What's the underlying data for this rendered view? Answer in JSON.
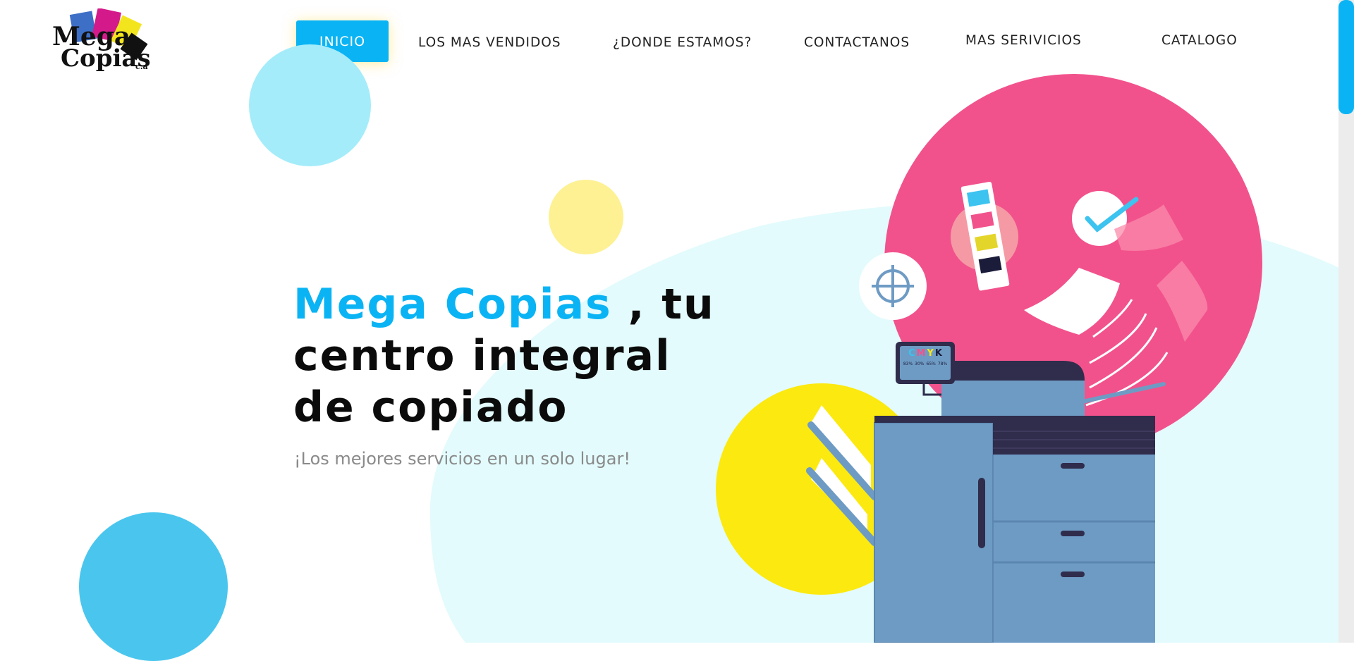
{
  "brand": {
    "logo_line1": "Mega",
    "logo_line2": "Copias",
    "logo_suffix": "c.a"
  },
  "nav": {
    "items": [
      {
        "label": "INICIO",
        "active": true
      },
      {
        "label": "LOS MAS VENDIDOS"
      },
      {
        "label": "¿DONDE ESTAMOS?"
      },
      {
        "label": "CONTACTANOS"
      },
      {
        "label": "MAS SERIVICIOS"
      },
      {
        "label": "CATALOGO"
      }
    ]
  },
  "hero": {
    "brand": "Mega Copias",
    "title_rest": " , tu centro integral de copiado",
    "subtitle": "¡Los mejores servicios en un solo lugar!"
  },
  "illustration": {
    "monitor_letters": [
      "C",
      "M",
      "Y",
      "K"
    ],
    "monitor_values": [
      "83%",
      "30%",
      "65%",
      "78%"
    ]
  },
  "colors": {
    "accent": "#0ab4f4",
    "pink": "#f2528c",
    "yellow": "#fce90f",
    "light_cyan": "#e3fbfc",
    "printer_blue": "#6e9bc4",
    "printer_dark": "#2f2c4c"
  }
}
